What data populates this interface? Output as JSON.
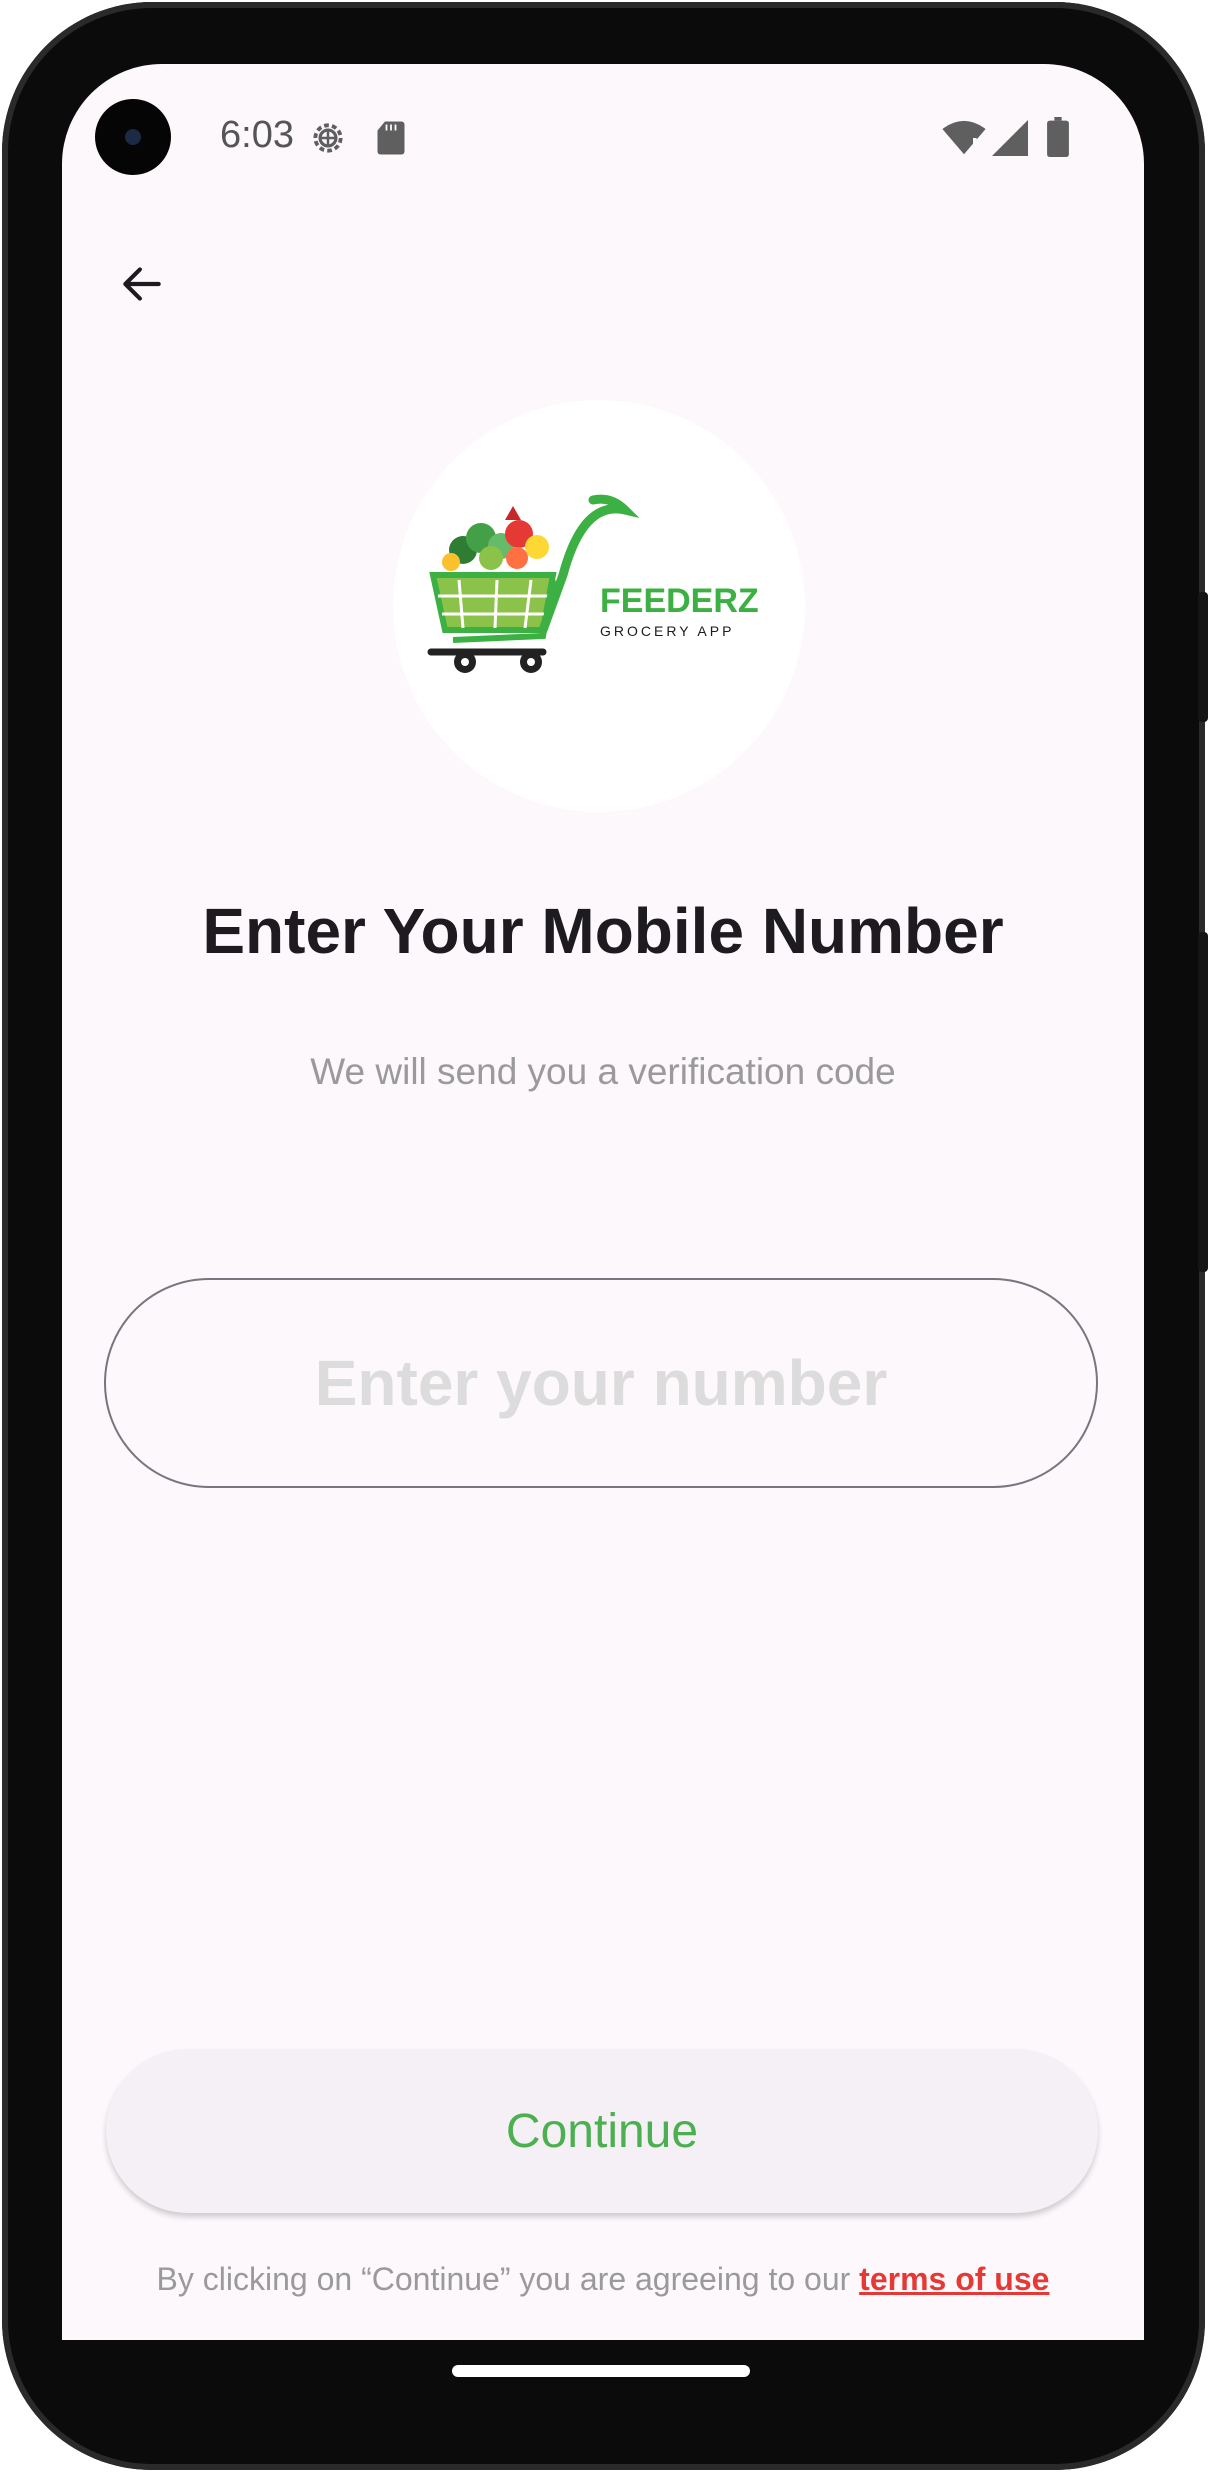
{
  "status_bar": {
    "time": "6:03",
    "icons": [
      "settings-icon",
      "sd-card-icon",
      "wifi-icon",
      "signal-icon",
      "battery-icon"
    ]
  },
  "header": {
    "back_icon": "arrow-back-icon"
  },
  "logo": {
    "name": "FEEDERZ",
    "tagline": "GROCERY APP",
    "colors": {
      "brand_green": "#3cb043",
      "dark": "#1d1b20"
    }
  },
  "main": {
    "title": "Enter Your Mobile Number",
    "subtitle": "We will send you a verification code",
    "phone_field": {
      "placeholder": "Enter your number",
      "value": ""
    }
  },
  "footer": {
    "continue_label": "Continue",
    "terms_prefix": "By clicking on “Continue” you are agreeing to our ",
    "terms_link": "terms of use"
  },
  "colors": {
    "accent_green": "#4caf50",
    "link_red": "#e53935",
    "background": "#fcf8fc"
  }
}
